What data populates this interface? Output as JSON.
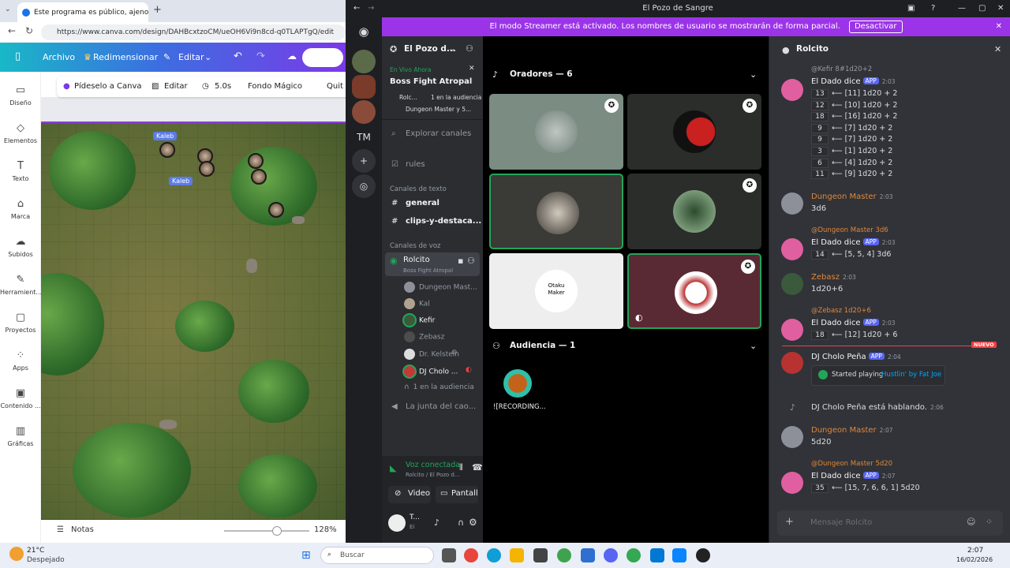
{
  "browser": {
    "tab_title": "Este programa es público, ajeno a",
    "url": "https://www.canva.com/design/DAHBcxtzoCM/ueOH6Vi9n8cd-q0TLAPTgQ/edit"
  },
  "canva": {
    "menu": {
      "file": "Archivo",
      "resize": "Redimensionar",
      "edit": "Editar"
    },
    "context": {
      "ask": "Pídeselo a Canva",
      "edit": "Editar",
      "duration": "5.0s",
      "magic": "Fondo Mágico",
      "quit": "Quit"
    },
    "rail": [
      "Diseño",
      "Elementos",
      "Texto",
      "Marca",
      "Subidos",
      "Herramient...",
      "Proyectos",
      "Apps",
      "Contenido ...",
      "Gráficas"
    ],
    "token_label": "Kaleb",
    "notes": "Notas",
    "zoom": "128%"
  },
  "discord": {
    "window_title": "El Pozo de Sangre",
    "streamer_banner": "El modo Streamer está activado. Los nombres de usuario se mostrarán de forma parcial.",
    "streamer_button": "Desactivar",
    "guild_tm": "TM",
    "server_name": "El Pozo d...",
    "live": {
      "badge": "En Vivo Ahora",
      "title": "Boss Fight Atropal",
      "line1_a": "Rolc...",
      "line1_b": "1 en la audiencia",
      "line2": "Dungeon Master y 5..."
    },
    "explore": "Explorar canales",
    "rules": "rules",
    "text_category": "Canales de texto",
    "text_channels": [
      "general",
      "clips-y-destaca..."
    ],
    "voice_category": "Canales de voz",
    "voice_channel": "Rolcito",
    "voice_channel_sub": "Boss Fight Atropal",
    "voice_users": [
      "Dungeon Mast...",
      "Kal",
      "Kefir",
      "Zebasz",
      "Dr. Kelstein",
      "DJ Cholo ..."
    ],
    "audience_line": "1 en la audiencia",
    "other_voice": "La junta del cao...",
    "voice_status": "Voz conectada",
    "voice_status_sub": "Rolcito / El Pozo d...",
    "video_btn": "Video",
    "screen_btn": "Pantall",
    "user_short": "T...",
    "user_status": "Ei",
    "speakers_header": "Oradores — 6",
    "audience_header": "Audiencia — 1",
    "audience_name": "![RECORDING...",
    "tile_text": "Otaku\nMaker",
    "chat_title": "Rolcito",
    "chat_input": "Mensaje Rolcito",
    "new_badge": "NUEVO",
    "messages": {
      "m1_reply": "@Kefir 8#1d20+2",
      "dice_name": "El Dado dice",
      "app": "APP",
      "ts_203": "2:03",
      "ts_204": "2:04",
      "ts_206": "2:06",
      "ts_207": "2:07",
      "rolls1": [
        {
          "n": "13",
          "t": "⟵ [11] 1d20 + 2"
        },
        {
          "n": "12",
          "t": "⟵ [10] 1d20 + 2"
        },
        {
          "n": "18",
          "t": "⟵ [16] 1d20 + 2"
        },
        {
          "n": "9",
          "t": "⟵ [7] 1d20 + 2"
        },
        {
          "n": "9",
          "t": "⟵ [7] 1d20 + 2"
        },
        {
          "n": "3",
          "t": "⟵ [1] 1d20 + 2"
        },
        {
          "n": "6",
          "t": "⟵ [4] 1d20 + 2"
        },
        {
          "n": "11",
          "t": "⟵ [9] 1d20 + 2"
        }
      ],
      "dm_name": "Dungeon Master",
      "dm_text1": "3d6",
      "reply2": "@Dungeon Master 3d6",
      "roll2": {
        "n": "14",
        "t": "⟵ [5, 5, 4] 3d6"
      },
      "zebasz_name": "Zebasz",
      "zebasz_text": "1d20+6",
      "reply3": "@Zebasz 1d20+6",
      "roll3": {
        "n": "18",
        "t": "⟵ [12] 1d20 + 6"
      },
      "dj_name": "DJ Cholo Peña",
      "dj_started": "Started playing",
      "dj_song": "Hustlin' by Fat Joe",
      "dj_speaking": "DJ Cholo Peña está hablando.",
      "dm_text2": "5d20",
      "reply4": "@Dungeon Master 5d20",
      "roll4": {
        "n": "35",
        "t": "⟵ [15, 7, 6, 6, 1] 5d20"
      }
    }
  },
  "taskbar": {
    "weather_temp": "21°C",
    "weather_desc": "Despejado",
    "search": "Buscar",
    "time": "2:07",
    "date": "16/02/2026"
  },
  "colors": {
    "streamer": "#9b34e8",
    "discord_bg": "#313338",
    "dm_name": "#e0873a",
    "blurple": "#5865f2",
    "green": "#23a559",
    "new_red": "#f23f43"
  }
}
